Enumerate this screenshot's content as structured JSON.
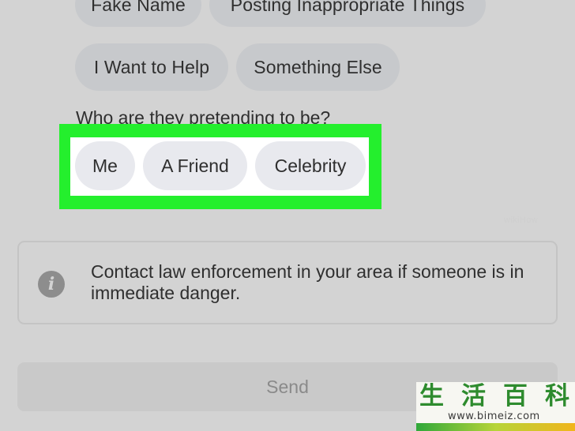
{
  "report_options": {
    "row1": [
      "Fake Name",
      "Posting Inappropriate Things"
    ],
    "row2": [
      "I Want to Help",
      "Something Else"
    ]
  },
  "pretend": {
    "question": "Who are they pretending to be?",
    "options": [
      "Me",
      "A Friend",
      "Celebrity"
    ],
    "highlight_color": "#24ef2d"
  },
  "notice": {
    "icon": "info-icon",
    "text": "Contact law enforcement in your area if someone is in immediate danger."
  },
  "send": {
    "label": "Send"
  },
  "watermark": {
    "chars": [
      "生",
      "活",
      "百",
      "科"
    ],
    "url": "www.bimeiz.com",
    "faint": "wikiHow"
  }
}
